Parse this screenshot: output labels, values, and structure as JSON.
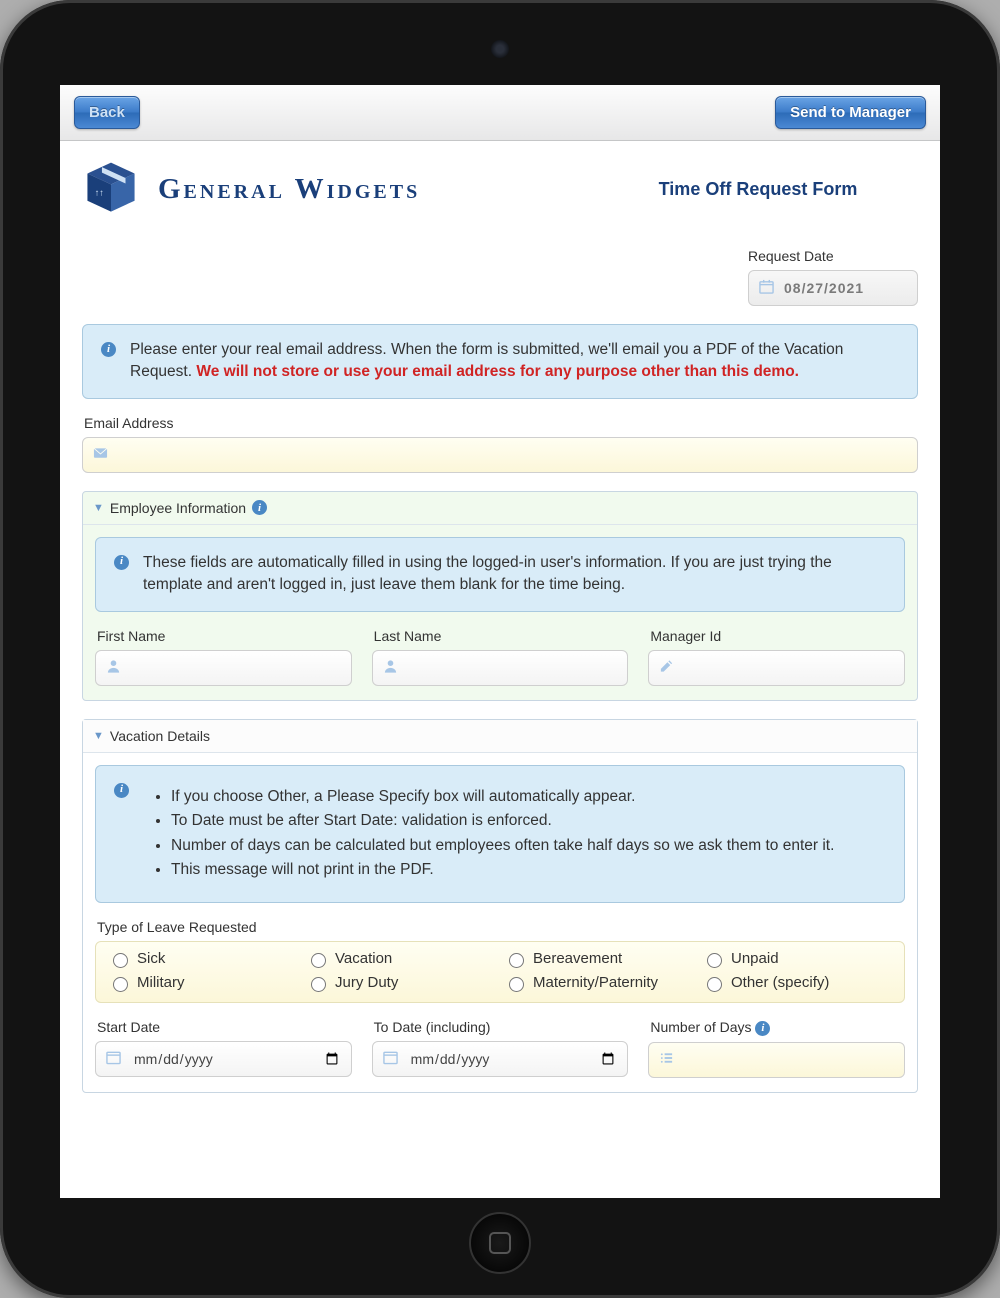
{
  "toolbar": {
    "back_label": "Back",
    "send_label": "Send to Manager"
  },
  "brand": {
    "name": "General Widgets"
  },
  "form_title": "Time Off Request Form",
  "request_date": {
    "label": "Request Date",
    "value": "08/27/2021"
  },
  "email_notice": {
    "text1": "Please enter your real email address. When the form is submitted, we'll email you a PDF of the Vacation Request. ",
    "text2": "We will not store or use your email address for any purpose other than this demo."
  },
  "email_field": {
    "label": "Email Address",
    "value": ""
  },
  "employee_section": {
    "title": "Employee Information",
    "notice": "These fields are automatically filled in using the logged-in user's information. If you are just trying the template and aren't logged in, just leave them blank for the time being.",
    "first_name": {
      "label": "First Name",
      "value": ""
    },
    "last_name": {
      "label": "Last Name",
      "value": ""
    },
    "manager_id": {
      "label": "Manager Id",
      "value": ""
    }
  },
  "vacation_section": {
    "title": "Vacation Details",
    "bullets": [
      "If you choose Other, a Please Specify box will automatically appear.",
      "To Date must be after Start Date: validation is enforced.",
      "Number of days can be calculated but employees often take half days so we ask them to enter it.",
      "This message will not print in the PDF."
    ],
    "leave_type_label": "Type of Leave Requested",
    "leave_types": [
      "Sick",
      "Vacation",
      "Bereavement",
      "Unpaid",
      "Military",
      "Jury Duty",
      "Maternity/Paternity",
      "Other (specify)"
    ],
    "start_date": {
      "label": "Start Date",
      "placeholder": "mm/dd/yyyy",
      "value": ""
    },
    "to_date": {
      "label": "To Date (including)",
      "placeholder": "mm/dd/yyyy",
      "value": ""
    },
    "num_days": {
      "label": "Number of Days",
      "value": ""
    }
  }
}
